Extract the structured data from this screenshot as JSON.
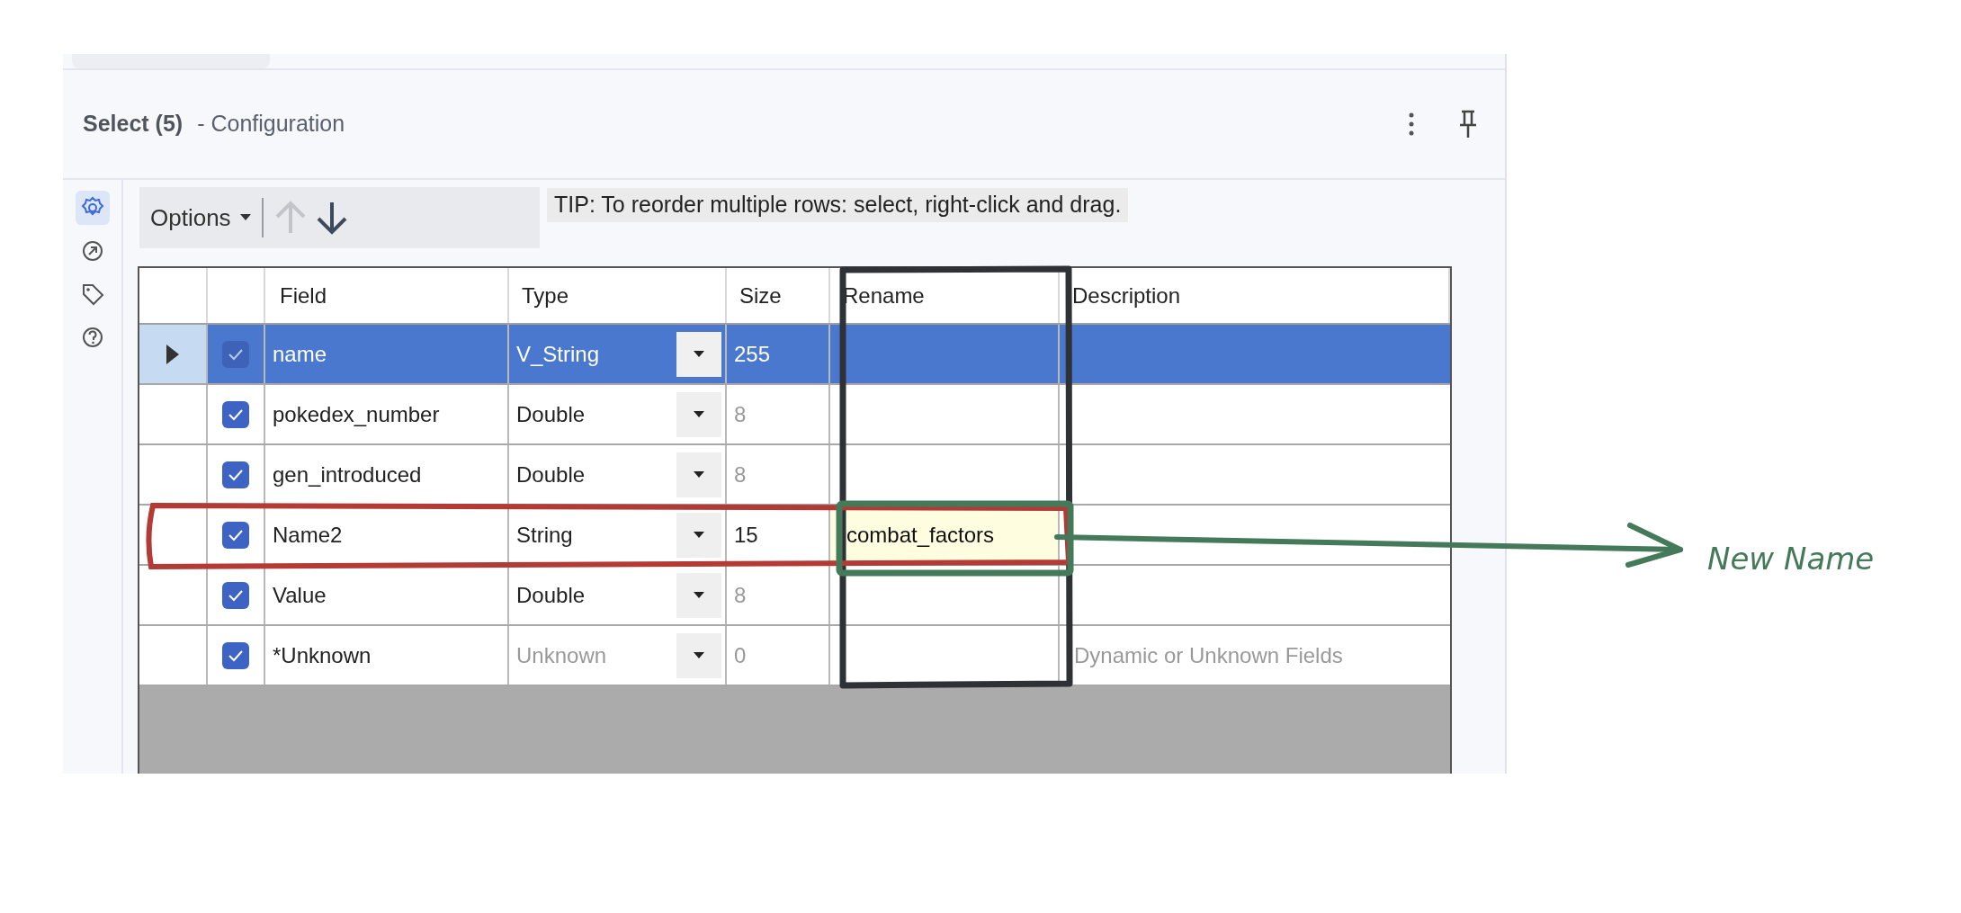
{
  "panel": {
    "title": "Select (5)",
    "subtitle": "- Configuration"
  },
  "side_icons": [
    {
      "kind": "gear",
      "selected": true
    },
    {
      "kind": "arrow",
      "selected": false
    },
    {
      "kind": "tag",
      "selected": false
    },
    {
      "kind": "help",
      "selected": false
    }
  ],
  "toolbar": {
    "options_label": "Options",
    "tip": "TIP: To reorder multiple rows: select, right-click and drag."
  },
  "table": {
    "columns": [
      "Field",
      "Type",
      "Size",
      "Rename",
      "Description"
    ],
    "rows": [
      {
        "selected": true,
        "checked": true,
        "field": "name",
        "type": "V_String",
        "type_disabled": false,
        "size": "255",
        "size_disabled": false
      },
      {
        "selected": false,
        "checked": true,
        "field": "pokedex_number",
        "type": "Double",
        "type_disabled": false,
        "size": "8",
        "size_disabled": true
      },
      {
        "selected": false,
        "checked": true,
        "field": "gen_introduced",
        "type": "Double",
        "type_disabled": false,
        "size": "8",
        "size_disabled": true
      },
      {
        "selected": false,
        "checked": true,
        "field": "Name2",
        "type": "String",
        "type_disabled": false,
        "size": "15",
        "size_disabled": false,
        "rename": "combat_factors",
        "editing": true
      },
      {
        "selected": false,
        "checked": true,
        "field": "Value",
        "type": "Double",
        "type_disabled": false,
        "size": "8",
        "size_disabled": true
      },
      {
        "selected": false,
        "checked": true,
        "field": "*Unknown",
        "type": "Unknown",
        "type_disabled": true,
        "size": "0",
        "size_disabled": true,
        "description": "Dynamic or Unknown Fields"
      }
    ]
  },
  "annotation": {
    "label": "New Name"
  }
}
